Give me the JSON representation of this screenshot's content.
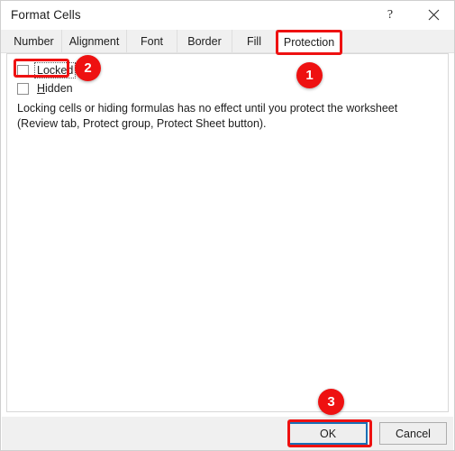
{
  "window": {
    "title": "Format Cells",
    "help_icon": "?",
    "help_icon_name": "help-icon",
    "close_icon_name": "close-icon"
  },
  "tabs": [
    {
      "label": "Number",
      "active": false
    },
    {
      "label": "Alignment",
      "active": false
    },
    {
      "label": "Font",
      "active": false
    },
    {
      "label": "Border",
      "active": false
    },
    {
      "label": "Fill",
      "active": false
    },
    {
      "label": "Protection",
      "active": true
    }
  ],
  "protection": {
    "checkboxes": [
      {
        "label": "Locked",
        "accel": "L",
        "checked": false,
        "focused": true
      },
      {
        "label": "Hidden",
        "accel": "H",
        "checked": false,
        "focused": false
      }
    ],
    "description": "Locking cells or hiding formulas has no effect until you protect the worksheet (Review tab, Protect group, Protect Sheet button)."
  },
  "footer": {
    "ok_label": "OK",
    "cancel_label": "Cancel",
    "ok_is_default": true
  },
  "annotations": {
    "accent_color": "#ee1111",
    "badges": [
      {
        "number": "1",
        "target": "protection-tab"
      },
      {
        "number": "2",
        "target": "locked-checkbox"
      },
      {
        "number": "3",
        "target": "ok-button"
      }
    ],
    "highlight_rects": [
      "protection-tab",
      "locked-checkbox",
      "ok-button"
    ]
  }
}
